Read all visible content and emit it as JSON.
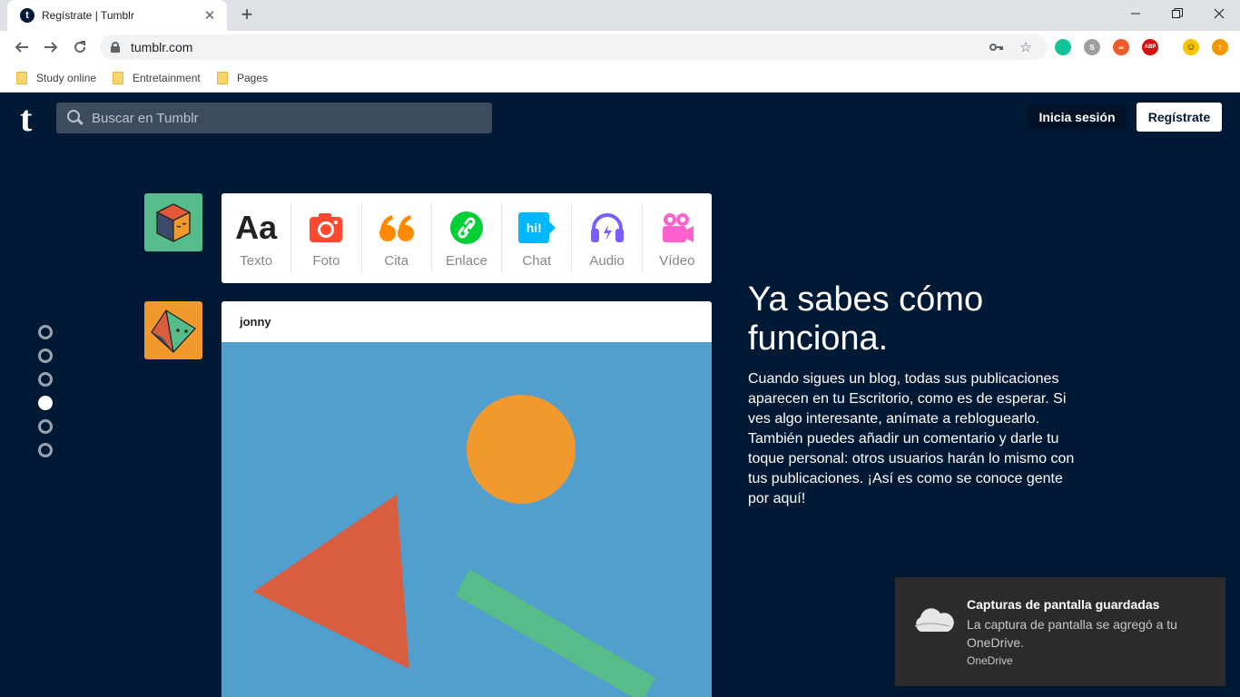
{
  "browser": {
    "tab_title": "Regístrate | Tumblr",
    "tab_favicon": "t",
    "url": "tumblr.com",
    "window_controls": [
      "minimize-icon",
      "restore-icon",
      "close-icon"
    ],
    "extensions": [
      {
        "name": "grammarly-icon",
        "color": "#15c39a",
        "label": ""
      },
      {
        "name": "s-extension-icon",
        "color": "#9e9e9e",
        "label": "S"
      },
      {
        "name": "infinity-extension-icon",
        "color": "#f05a28",
        "label": "∞"
      },
      {
        "name": "adblock-plus-icon",
        "color": "#d80f0f",
        "label": "ABP"
      },
      {
        "name": "smiley-extension-icon",
        "color": "#f7c600",
        "label": ""
      },
      {
        "name": "update-alert-icon",
        "color": "#f29900",
        "label": "!"
      }
    ],
    "bookmarks": [
      "Study online",
      "Entretainment",
      "Pages"
    ]
  },
  "header": {
    "logo": "t",
    "search_placeholder": "Buscar en Tumblr",
    "login_label": "Inicia sesión",
    "signup_label": "Regístrate"
  },
  "post_types": [
    {
      "label": "Texto",
      "icon": "text-icon",
      "glyph": "Aa",
      "color": "#222222"
    },
    {
      "label": "Foto",
      "icon": "camera-icon",
      "glyph": "",
      "color": "#ff492f"
    },
    {
      "label": "Cita",
      "icon": "quote-icon",
      "glyph": "❝",
      "color": "#ff8a00"
    },
    {
      "label": "Enlace",
      "icon": "link-icon",
      "glyph": "",
      "color": "#00cf35"
    },
    {
      "label": "Chat",
      "icon": "chat-icon",
      "glyph": "hi!",
      "color": "#00b8ff"
    },
    {
      "label": "Audio",
      "icon": "headphones-icon",
      "glyph": "",
      "color": "#7c5cff"
    },
    {
      "label": "Vídeo",
      "icon": "video-camera-icon",
      "glyph": "",
      "color": "#ff62ce"
    }
  ],
  "post": {
    "author": "jonny",
    "image_bg": "#529ecc",
    "shapes": [
      "orange-circle",
      "red-triangle",
      "green-bar"
    ]
  },
  "pager": {
    "count": 6,
    "active_index": 3
  },
  "intro": {
    "headline": "Ya sabes cómo funciona.",
    "body": "Cuando sigues un blog, todas sus publicaciones aparecen en tu Escritorio, como es de esperar. Si ves algo interesante, anímate a rebloguearlo. También puedes añadir un comentario y darle tu toque personal: otros usuarios harán lo mismo con tus publicaciones. ¡Así es como se conoce gente por aquí!"
  },
  "notification": {
    "title": "Capturas de pantalla guardadas",
    "body": "La captura de pantalla se agregó a tu OneDrive.",
    "source": "OneDrive"
  },
  "colors": {
    "page_bg": "#001935",
    "avatar_cube_bg": "#56bc8a",
    "avatar_gem_bg": "#f2992e",
    "circle": "#f2992e",
    "triangle": "#d95e40",
    "bar": "#56bc8a"
  }
}
